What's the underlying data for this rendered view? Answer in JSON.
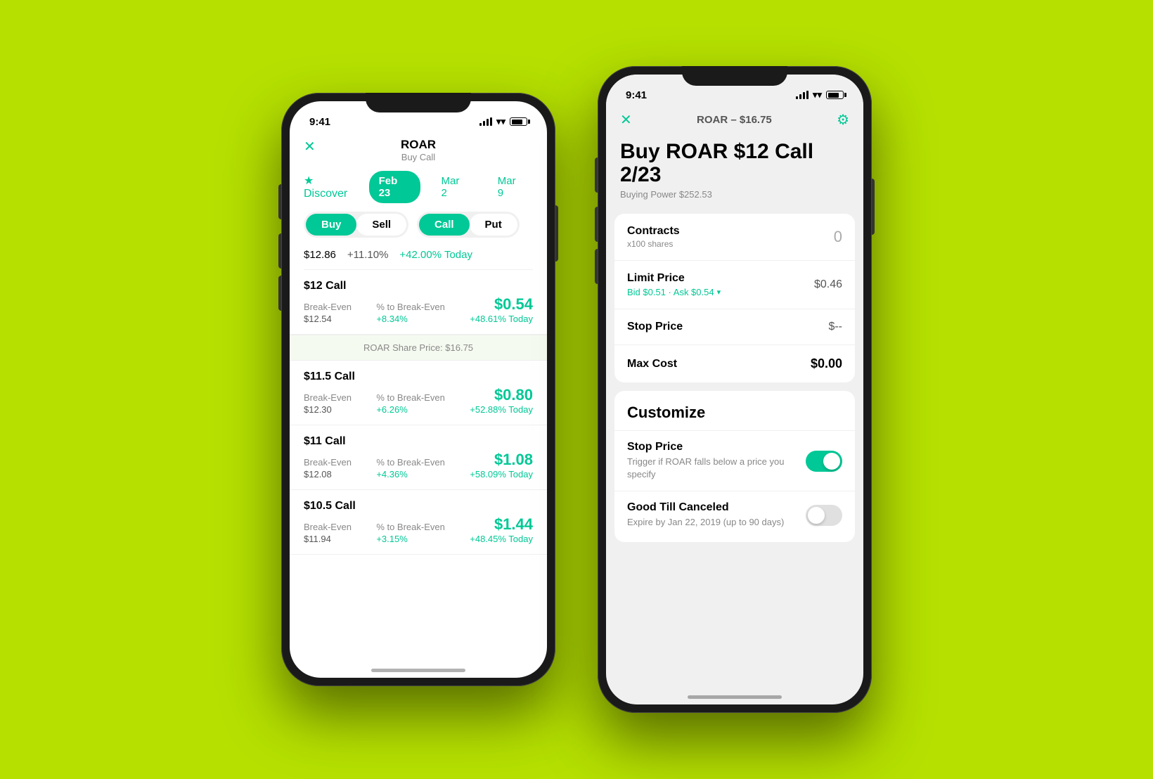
{
  "background_color": "#b5e000",
  "phone1": {
    "status_time": "9:41",
    "header": {
      "title": "ROAR",
      "subtitle": "Buy Call"
    },
    "tabs": {
      "discover": "★  Discover",
      "dates": [
        "Feb 23",
        "Mar 2",
        "Mar 9"
      ]
    },
    "active_tab": "Feb 23",
    "buy_sell": [
      "Buy",
      "Sell"
    ],
    "call_put": [
      "Call",
      "Put"
    ],
    "stock_info": {
      "price": "$12.86",
      "change": "+11.10%",
      "pct_today": "+42.00% Today"
    },
    "options": [
      {
        "name": "$12 Call",
        "breakeven_label": "Break-Even",
        "breakeven_val": "$12.54",
        "pct_label": "% to Break-Even",
        "pct_val": "+8.34%",
        "price": "$0.54",
        "today": "+48.61% Today"
      },
      {
        "name": "$11.5 Call",
        "breakeven_label": "Break-Even",
        "breakeven_val": "$12.30",
        "pct_label": "% to Break-Even",
        "pct_val": "+6.26%",
        "price": "$0.80",
        "today": "+52.88% Today"
      },
      {
        "name": "$11 Call",
        "breakeven_label": "Break-Even",
        "breakeven_val": "$12.08",
        "pct_label": "% to Break-Even",
        "pct_val": "+4.36%",
        "price": "$1.08",
        "today": "+58.09% Today"
      },
      {
        "name": "$10.5 Call",
        "breakeven_label": "Break-Even",
        "breakeven_val": "$11.94",
        "pct_label": "% to Break-Even",
        "pct_val": "+3.15%",
        "price": "$1.44",
        "today": "+48.45% Today"
      }
    ],
    "share_price_banner": "ROAR Share Price: $16.75"
  },
  "phone2": {
    "status_time": "9:41",
    "header": {
      "ticker_price": "ROAR – $16.75"
    },
    "trade": {
      "title": "Buy ROAR $12 Call 2/23",
      "buying_power": "Buying Power $252.53"
    },
    "form": {
      "contracts_label": "Contracts",
      "contracts_sublabel": "x100 shares",
      "contracts_value": "0",
      "limit_price_label": "Limit Price",
      "bid_ask": "Bid $0.51 · Ask $0.54",
      "limit_price_value": "$0.46",
      "stop_price_label": "Stop Price",
      "stop_price_value": "$--",
      "max_cost_label": "Max Cost",
      "max_cost_value": "$0.00"
    },
    "customize": {
      "title": "Customize",
      "stop_price": {
        "label": "Stop Price",
        "description": "Trigger if ROAR falls below a price you specify",
        "enabled": true
      },
      "good_till_canceled": {
        "label": "Good Till Canceled",
        "description": "Expire by Jan 22, 2019 (up to 90 days)",
        "enabled": false
      }
    }
  }
}
